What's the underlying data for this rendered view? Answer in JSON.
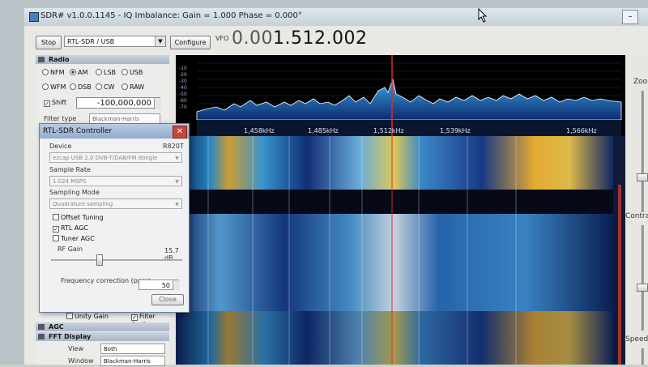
{
  "window": {
    "title": "SDR# v1.0.0.1145 - IQ Imbalance: Gain = 1.000 Phase = 0.000°"
  },
  "toolbar": {
    "stop_label": "Stop",
    "source_value": "RTL-SDR / USB",
    "configure_label": "Configure",
    "vfo_label": "VFO",
    "vfo_dim": "0.00",
    "vfo_bright": "1.512.002"
  },
  "radio_section": {
    "title": "Radio",
    "modes": [
      "NFM",
      "AM",
      "LSB",
      "USB",
      "WFM",
      "DSB",
      "CW",
      "RAW"
    ],
    "selected_mode": "AM",
    "shift_label": "Shift",
    "shift_checked": true,
    "shift_value": "-100,000,000",
    "filter_type_label": "Filter type",
    "filter_type_value": "Blackman-Harris"
  },
  "spectrum": {
    "db_labels": [
      "-10",
      "-20",
      "-30",
      "-40",
      "-50",
      "-60",
      "-70"
    ],
    "freq_labels": [
      "1,458kHz",
      "1,485kHz",
      "1,512kHz",
      "1,539kHz",
      "1,566kHz"
    ]
  },
  "right_panel": {
    "zoom_label": "Zoom",
    "contrast_label": "Contrast",
    "speed_label": "Speed"
  },
  "dialog": {
    "title": "RTL-SDR Controller",
    "device_label": "Device",
    "tuner": "R820T",
    "device_value": "ezcap USB 2.0 DVB-T/DAB/FM dongle",
    "sample_rate_label": "Sample Rate",
    "sample_rate_value": "1.024 MSPS",
    "sampling_mode_label": "Sampling Mode",
    "sampling_mode_value": "Quadrature sampling",
    "offset_tuning_label": "Offset Tuning",
    "rtl_agc_label": "RTL AGC",
    "tuner_agc_label": "Tuner AGC",
    "rf_gain_label": "RF Gain",
    "rf_gain_value": "15.7 dB",
    "freq_corr_label": "Frequency correction (ppm)",
    "freq_corr_value": "50",
    "close_label": "Close"
  },
  "audio": {
    "unity_gain_label": "Unity Gain",
    "filter_audio_label": "Filter Audio"
  },
  "agc": {
    "title": "AGC"
  },
  "fft_display": {
    "title": "FFT Display",
    "view_label": "View",
    "view_value": "Both",
    "window_label": "Window",
    "window_value": "Blackman-Harris"
  }
}
